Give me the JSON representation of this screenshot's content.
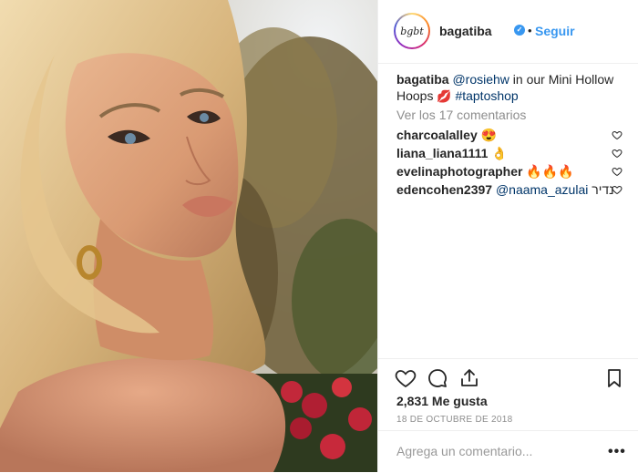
{
  "post": {
    "header": {
      "avatar_icon": "signature-avatar",
      "avatar_text": "bgbt",
      "username": "bagatiba",
      "verified_icon": "verified-badge-icon",
      "separator": "•",
      "follow_label": "Seguir"
    },
    "caption": {
      "username": "bagatiba",
      "mention": "@rosiehw",
      "text": " in our Mini Hollow Hoops ",
      "emoji": "💋",
      "hashtag": "#taptoshop"
    },
    "view_all_comments": "Ver los 17 comentarios",
    "comments": [
      {
        "username": "charcoalalley",
        "text": "😍"
      },
      {
        "username": "liana_liana1111",
        "text": "👌"
      },
      {
        "username": "evelinaphotographer",
        "text": "🔥🔥🔥"
      },
      {
        "username": "edencohen2397",
        "mention": "@naama_azulai",
        "text": "נדיר"
      }
    ],
    "likes": "2,831 Me gusta",
    "date": "18 DE OCTUBRE DE 2018",
    "add_comment_placeholder": "Agrega un comentario...",
    "more_options": "•••",
    "colors": {
      "accent": "#3897f0",
      "link": "#003569",
      "muted": "#8e8e8e",
      "text": "#262626"
    }
  }
}
